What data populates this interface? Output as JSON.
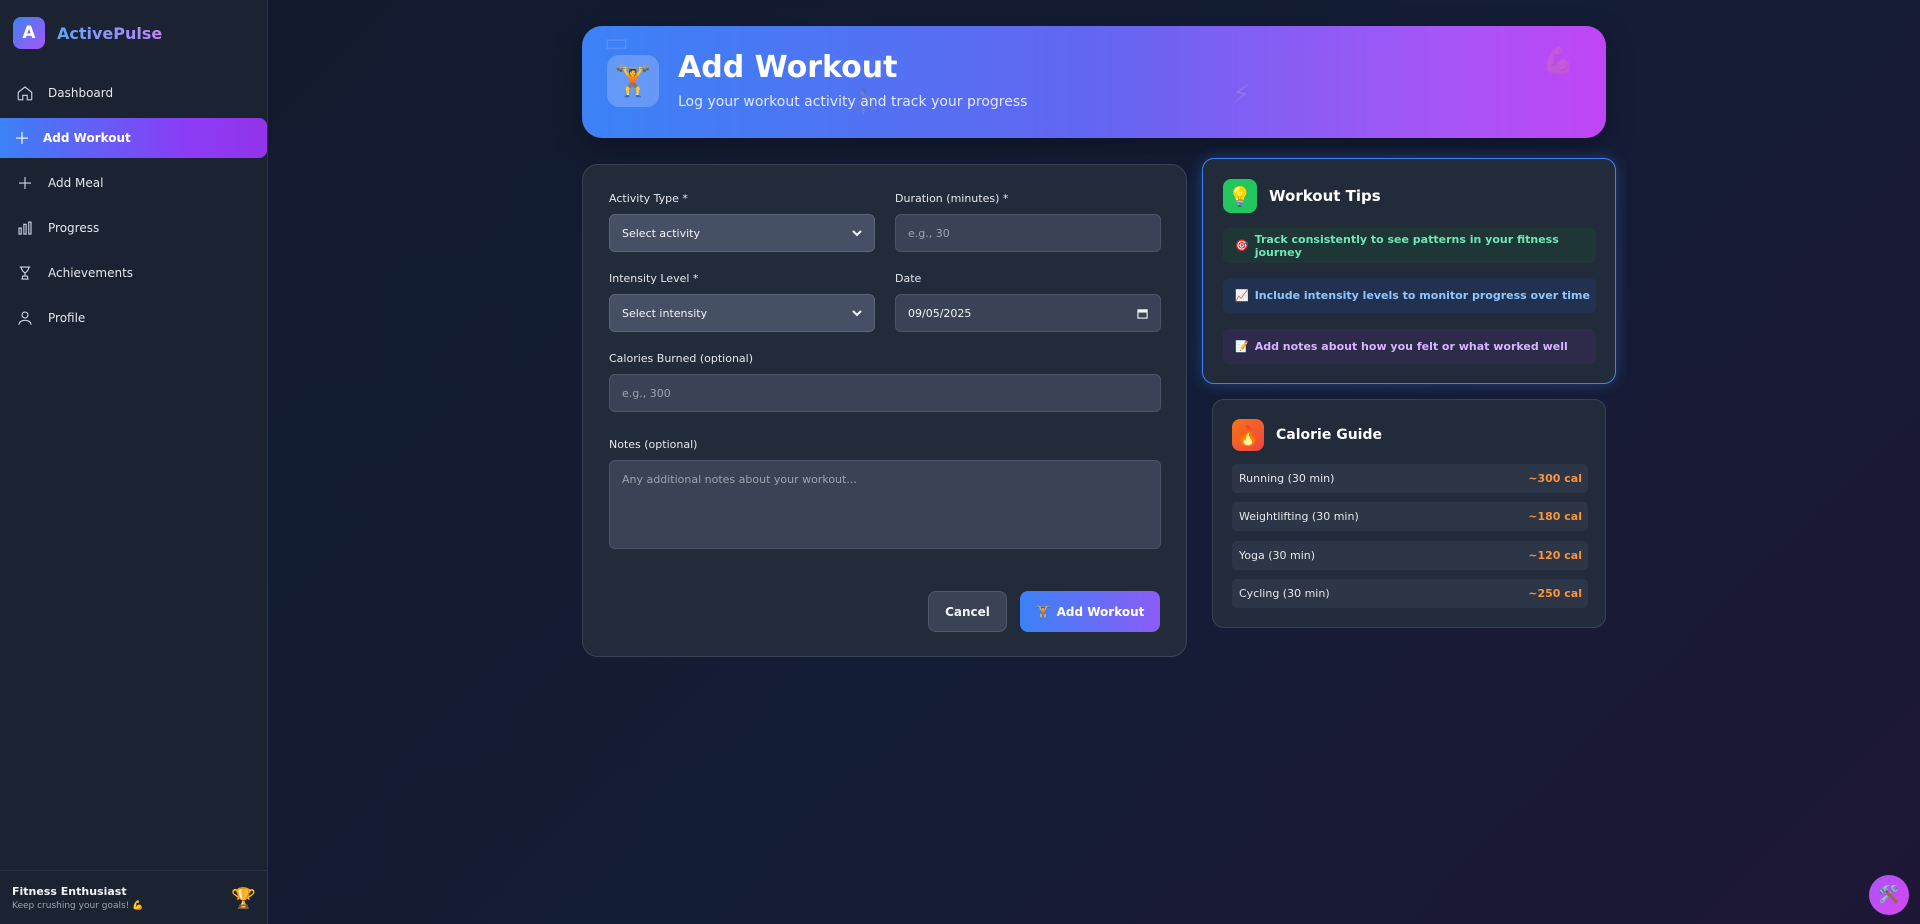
{
  "brand": {
    "logo_letter": "A",
    "name": "ActivePulse"
  },
  "nav": {
    "items": [
      {
        "label": "Dashboard",
        "icon": "home-icon"
      },
      {
        "label": "Add Workout",
        "icon": "plus-icon",
        "active": true
      },
      {
        "label": "Add Meal",
        "icon": "plus-icon"
      },
      {
        "label": "Progress",
        "icon": "bar-chart-icon"
      },
      {
        "label": "Achievements",
        "icon": "trophy-outline-icon"
      },
      {
        "label": "Profile",
        "icon": "user-icon"
      }
    ]
  },
  "footer": {
    "name": "Fitness Enthusiast",
    "tagline": "Keep crushing your goals! 💪",
    "icon": "🏆"
  },
  "hero": {
    "icon": "🏋️",
    "title": "Add Workout",
    "subtitle": "Log your workout activity and track your progress"
  },
  "form": {
    "activity": {
      "label": "Activity Type *",
      "value": "Select activity"
    },
    "duration": {
      "label": "Duration (minutes) *",
      "placeholder": "e.g., 30"
    },
    "intensity": {
      "label": "Intensity Level *",
      "value": "Select intensity"
    },
    "date": {
      "label": "Date",
      "value": "09/05/2025"
    },
    "calories": {
      "label": "Calories Burned (optional)",
      "placeholder": "e.g., 300"
    },
    "notes": {
      "label": "Notes (optional)",
      "placeholder": "Any additional notes about your workout..."
    },
    "cancel_label": "Cancel",
    "submit_label": "Add Workout",
    "submit_icon": "🏋️"
  },
  "tips": {
    "icon": "💡",
    "title": "Workout Tips",
    "items": [
      {
        "icon": "🎯",
        "text": "Track consistently to see patterns in your fitness journey"
      },
      {
        "icon": "📈",
        "text": "Include intensity levels to monitor progress over time"
      },
      {
        "icon": "📝",
        "text": "Add notes about how you felt or what worked well"
      }
    ]
  },
  "calorie_guide": {
    "icon": "🔥",
    "title": "Calorie Guide",
    "rows": [
      {
        "activity": "Running (30 min)",
        "value": "~300 cal"
      },
      {
        "activity": "Weightlifting (30 min)",
        "value": "~180 cal"
      },
      {
        "activity": "Yoga (30 min)",
        "value": "~120 cal"
      },
      {
        "activity": "Cycling (30 min)",
        "value": "~250 cal"
      }
    ]
  },
  "fab": {
    "icon": "🛠️"
  },
  "colors": {
    "accent_blue": "#3b82f6",
    "accent_purple": "#a855f7",
    "calorie_orange": "#fb923c"
  }
}
